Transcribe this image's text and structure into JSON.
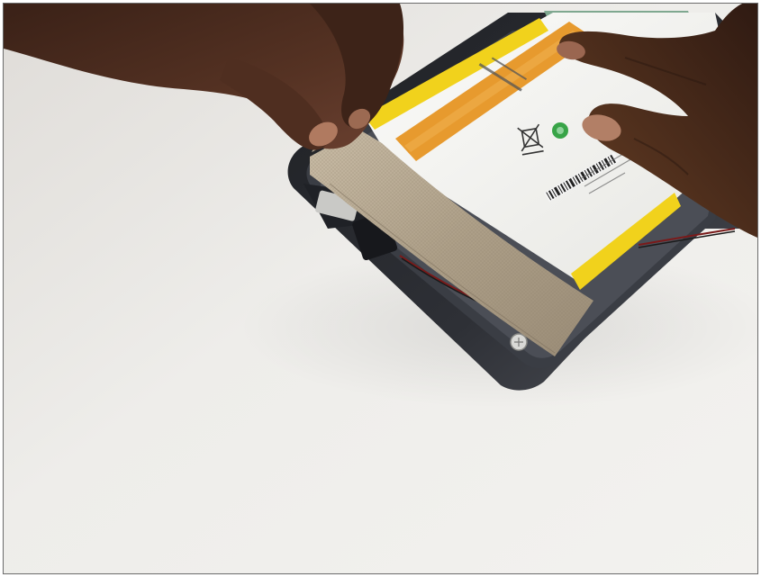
{
  "image": {
    "kind": "photo",
    "subject": "hands-peeling-tape-over-tablet-battery"
  },
  "colors": {
    "background": "#e9e8e6",
    "tablet_frame": "#2a2c31",
    "battery": "#f4f4f2",
    "battery_tape_yellow": "#f1d21c",
    "orange_strip": "#e79a2e",
    "copper_tape": "#b7a892",
    "skin": "#4b2b1d",
    "green_logo": "#38a447"
  }
}
